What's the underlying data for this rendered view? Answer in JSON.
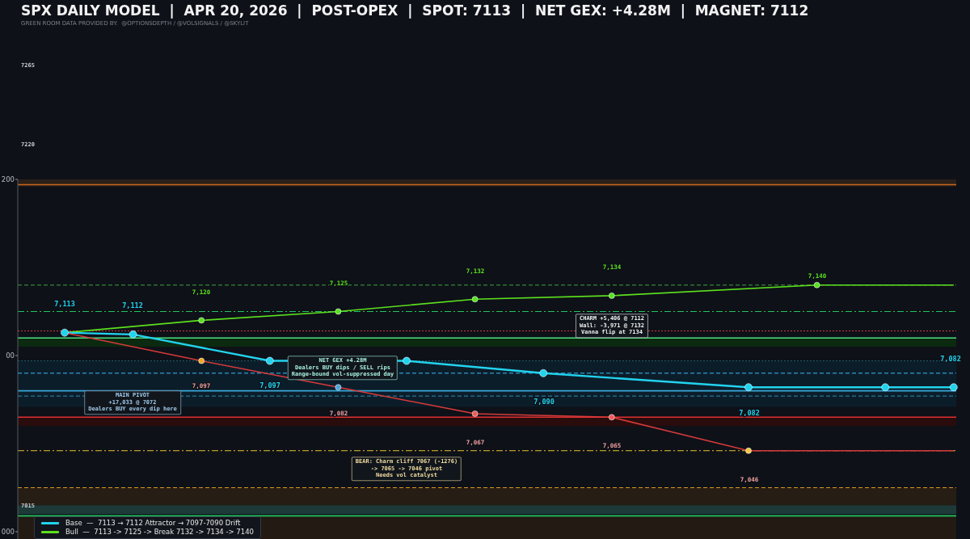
{
  "title": "SPX DAILY MODEL  |  APR 20, 2026  |  POST-OPEX  |  SPOT: 7113  |  NET GEX: +4.28M  |  MAGNET: 7112",
  "subtitle": "GREEN ROOM DATA PROVIDED BY:  @OPTIONSDEPTH / @VOLSIGNALS / @SKYLIT",
  "axis_labels": [
    "200",
    "00",
    "000"
  ],
  "level_labels": [
    "7265",
    "7220",
    "7015"
  ],
  "series": [
    {
      "color": "#5ce01e",
      "point_labels": [
        "7,120",
        "7,125",
        "7,132",
        "7,134",
        "7,140"
      ]
    },
    {
      "color": "#22d3ee",
      "point_labels": [
        "7,113",
        "7,112",
        "7,097",
        "7,090",
        "7,082",
        "7,082"
      ]
    },
    {
      "color": "#d63a3a",
      "point_labels": [
        "7,097",
        "7,082",
        "7,067",
        "7,065",
        "7,046"
      ]
    }
  ],
  "callouts": [
    {
      "lines": [
        "MAIN PIVOT",
        "+17,033 @ 7072",
        "Dealers BUY every dip here"
      ],
      "color": "#9fc8e8"
    },
    {
      "lines": [
        "NET GEX +4.28M",
        "Dealers BUY dips / SELL rips",
        "Range-bound vol-suppressed day"
      ],
      "color": "#a8f0e0"
    },
    {
      "lines": [
        "CHARM +5,406 @ 7112",
        "Wall: -3,971 @ 7132",
        "Vanna flip at 7134"
      ],
      "color": "#f0f0f0"
    },
    {
      "lines": [
        "BEAR: Charm cliff 7067 (-1276)",
        "-> 7065 -> 7046 pivot",
        "Needs vol catalyst"
      ],
      "color": "#f0dca0"
    }
  ],
  "legend": [
    {
      "label": "Base  —  7113 → 7112 Attractor → 7097-7090 Drift",
      "color": "#22d3ee"
    },
    {
      "label": "Bull  —  7113 -> 7125 -> Break 7132 -> 7134 -> 7140",
      "color": "#5ce01e"
    }
  ]
}
